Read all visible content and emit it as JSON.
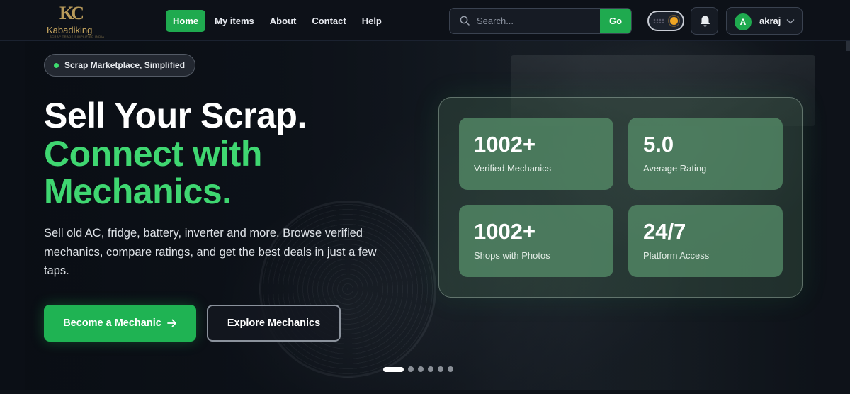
{
  "brand": {
    "mark": "KC",
    "name": "Kabadiking",
    "tagline": "SCRAP TRADE SIMPLIFIED INDIA"
  },
  "nav": {
    "items": [
      {
        "label": "Home",
        "active": true
      },
      {
        "label": "My items"
      },
      {
        "label": "About"
      },
      {
        "label": "Contact"
      },
      {
        "label": "Help"
      }
    ]
  },
  "search": {
    "placeholder": "Search...",
    "button_label": "Go"
  },
  "theme_toggle": {
    "icon": "sun-icon"
  },
  "notifications": {
    "icon": "bell-icon"
  },
  "user": {
    "avatar_initial": "A",
    "name": "akraj",
    "icon": "chevron-down-icon"
  },
  "hero": {
    "badge": "Scrap Marketplace, Simplified",
    "headline_line1": "Sell Your Scrap.",
    "headline_line2": "Connect with",
    "headline_line3": "Mechanics.",
    "description": "Sell old AC, fridge, battery, inverter and more. Browse verified mechanics, compare ratings, and get the best deals in just a few taps.",
    "primary_button": "Become a Mechanic",
    "primary_icon": "arrow-right-icon",
    "secondary_button": "Explore Mechanics",
    "carousel": {
      "slide_count": 6,
      "active_index": 0
    }
  },
  "stats": [
    {
      "value": "1002+",
      "label": "Verified Mechanics"
    },
    {
      "value": "5.0",
      "label": "Average Rating"
    },
    {
      "value": "1002+",
      "label": "Shops with Photos"
    },
    {
      "value": "24/7",
      "label": "Platform Access"
    }
  ],
  "colors": {
    "accent": "#1faa4f",
    "headline_green": "#3fd771",
    "background": "#0d1118"
  }
}
